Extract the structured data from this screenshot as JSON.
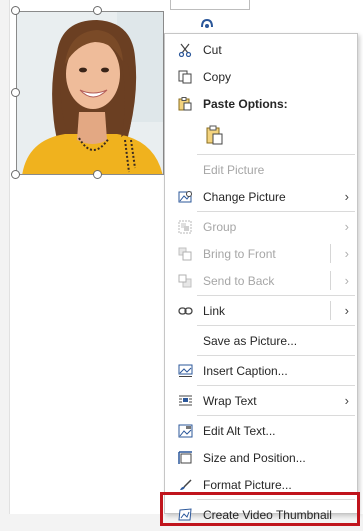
{
  "menu": {
    "cut": "Cut",
    "copy": "Copy",
    "paste_options": "Paste Options:",
    "edit_picture": "Edit Picture",
    "change_picture": "Change Picture",
    "group": "Group",
    "bring_to_front": "Bring to Front",
    "send_to_back": "Send to Back",
    "link": "Link",
    "save_as_picture": "Save as Picture...",
    "insert_caption": "Insert Caption...",
    "wrap_text": "Wrap Text",
    "edit_alt_text": "Edit Alt Text...",
    "size_and_position": "Size and Position...",
    "format_picture": "Format Picture...",
    "create_video_thumbnail": "Create Video Thumbnail"
  },
  "icons": {
    "cut": "scissors-icon",
    "copy": "copy-icon",
    "paste": "clipboard-icon",
    "change_picture": "change-picture-icon",
    "group": "group-icon",
    "bring_to_front": "bring-front-icon",
    "send_to_back": "send-back-icon",
    "link": "link-icon",
    "insert_caption": "caption-icon",
    "wrap_text": "wrap-text-icon",
    "edit_alt_text": "alt-text-icon",
    "size_and_position": "size-position-icon",
    "format_picture": "format-picture-icon",
    "create_video_thumbnail": "video-thumbnail-icon"
  },
  "colors": {
    "highlight_border": "#c0141c",
    "menu_border": "#c6c6c6",
    "disabled_text": "#a6a6a6"
  }
}
